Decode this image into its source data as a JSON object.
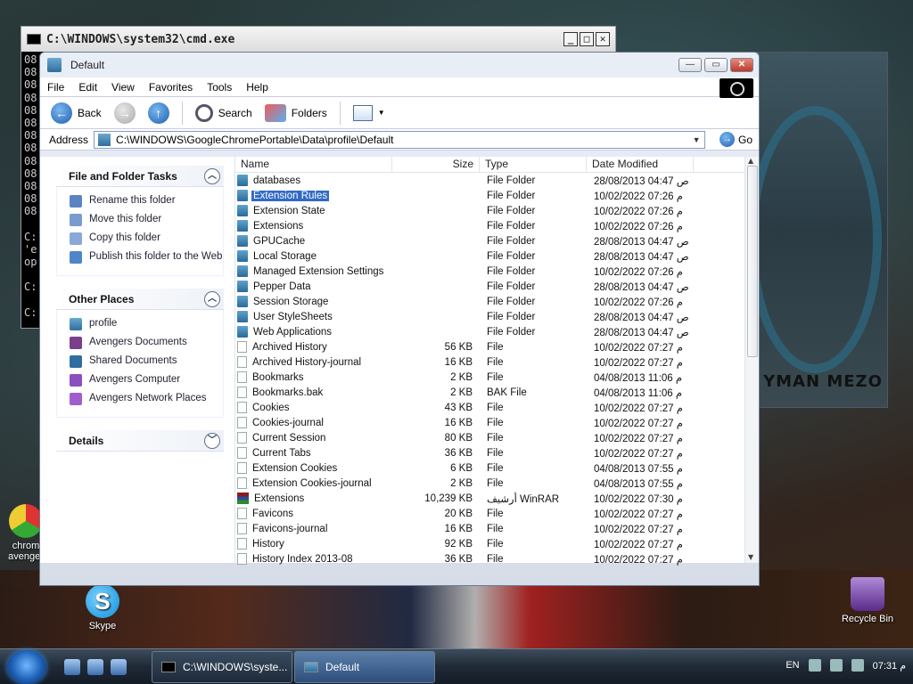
{
  "cmd": {
    "title": "C:\\WINDOWS\\system32\\cmd.exe",
    "lines": [
      "08",
      "08",
      "08",
      "08",
      "08",
      "08",
      "08",
      "08",
      "08",
      "08",
      "08",
      "08",
      "08",
      "",
      "C:",
      "'e",
      "op",
      "",
      "C:",
      "",
      "C:"
    ]
  },
  "window": {
    "title": "Default",
    "menu": [
      "File",
      "Edit",
      "View",
      "Favorites",
      "Tools",
      "Help"
    ],
    "toolbar": {
      "back": "Back",
      "search": "Search",
      "folders": "Folders"
    },
    "address": {
      "label": "Address",
      "value": "C:\\WINDOWS\\GoogleChromePortable\\Data\\profile\\Default",
      "go": "Go"
    }
  },
  "leftpane": {
    "tasks_title": "File and Folder Tasks",
    "tasks": [
      "Rename this folder",
      "Move this folder",
      "Copy this folder",
      "Publish this folder to the Web"
    ],
    "other_title": "Other Places",
    "places": [
      "profile",
      "Avengers Documents",
      "Shared Documents",
      "Avengers Computer",
      "Avengers Network Places"
    ],
    "details_title": "Details"
  },
  "columns": {
    "name": "Name",
    "size": "Size",
    "type": "Type",
    "date": "Date Modified"
  },
  "files": [
    {
      "name": "databases",
      "size": "",
      "type": "File Folder",
      "date": "28/08/2013 04:47 ص",
      "kind": "folder"
    },
    {
      "name": "Extension Rules",
      "size": "",
      "type": "File Folder",
      "date": "10/02/2022 07:26 م",
      "kind": "folder",
      "selected": true
    },
    {
      "name": "Extension State",
      "size": "",
      "type": "File Folder",
      "date": "10/02/2022 07:26 م",
      "kind": "folder"
    },
    {
      "name": "Extensions",
      "size": "",
      "type": "File Folder",
      "date": "10/02/2022 07:26 م",
      "kind": "folder"
    },
    {
      "name": "GPUCache",
      "size": "",
      "type": "File Folder",
      "date": "28/08/2013 04:47 ص",
      "kind": "folder"
    },
    {
      "name": "Local Storage",
      "size": "",
      "type": "File Folder",
      "date": "28/08/2013 04:47 ص",
      "kind": "folder"
    },
    {
      "name": "Managed Extension Settings",
      "size": "",
      "type": "File Folder",
      "date": "10/02/2022 07:26 م",
      "kind": "folder"
    },
    {
      "name": "Pepper Data",
      "size": "",
      "type": "File Folder",
      "date": "28/08/2013 04:47 ص",
      "kind": "folder"
    },
    {
      "name": "Session Storage",
      "size": "",
      "type": "File Folder",
      "date": "10/02/2022 07:26 م",
      "kind": "folder"
    },
    {
      "name": "User StyleSheets",
      "size": "",
      "type": "File Folder",
      "date": "28/08/2013 04:47 ص",
      "kind": "folder"
    },
    {
      "name": "Web Applications",
      "size": "",
      "type": "File Folder",
      "date": "28/08/2013 04:47 ص",
      "kind": "folder"
    },
    {
      "name": "Archived History",
      "size": "56 KB",
      "type": "File",
      "date": "10/02/2022 07:27 م",
      "kind": "file"
    },
    {
      "name": "Archived History-journal",
      "size": "16 KB",
      "type": "File",
      "date": "10/02/2022 07:27 م",
      "kind": "file"
    },
    {
      "name": "Bookmarks",
      "size": "2 KB",
      "type": "File",
      "date": "04/08/2013 11:06 م",
      "kind": "file"
    },
    {
      "name": "Bookmarks.bak",
      "size": "2 KB",
      "type": "BAK File",
      "date": "04/08/2013 11:06 م",
      "kind": "file"
    },
    {
      "name": "Cookies",
      "size": "43 KB",
      "type": "File",
      "date": "10/02/2022 07:27 م",
      "kind": "file"
    },
    {
      "name": "Cookies-journal",
      "size": "16 KB",
      "type": "File",
      "date": "10/02/2022 07:27 م",
      "kind": "file"
    },
    {
      "name": "Current Session",
      "size": "80 KB",
      "type": "File",
      "date": "10/02/2022 07:27 م",
      "kind": "file"
    },
    {
      "name": "Current Tabs",
      "size": "36 KB",
      "type": "File",
      "date": "10/02/2022 07:27 م",
      "kind": "file"
    },
    {
      "name": "Extension Cookies",
      "size": "6 KB",
      "type": "File",
      "date": "04/08/2013 07:55 م",
      "kind": "file"
    },
    {
      "name": "Extension Cookies-journal",
      "size": "2 KB",
      "type": "File",
      "date": "04/08/2013 07:55 م",
      "kind": "file"
    },
    {
      "name": "Extensions",
      "size": "10,239 KB",
      "type": "أرشيف WinRAR",
      "date": "10/02/2022 07:30 م",
      "kind": "rar"
    },
    {
      "name": "Favicons",
      "size": "20 KB",
      "type": "File",
      "date": "10/02/2022 07:27 م",
      "kind": "file"
    },
    {
      "name": "Favicons-journal",
      "size": "16 KB",
      "type": "File",
      "date": "10/02/2022 07:27 م",
      "kind": "file"
    },
    {
      "name": "History",
      "size": "92 KB",
      "type": "File",
      "date": "10/02/2022 07:27 م",
      "kind": "file"
    },
    {
      "name": "History Index 2013-08",
      "size": "36 KB",
      "type": "File",
      "date": "10/02/2022 07:27 م",
      "kind": "file"
    }
  ],
  "desktop": {
    "skype": "Skype",
    "recycle": "Recycle Bin",
    "chrome": "chrom avenger",
    "avengers_brand": "YMAN MEZO"
  },
  "taskbar": {
    "tasks": [
      "C:\\WINDOWS\\syste...",
      "Default"
    ],
    "lang": "EN",
    "clock": "07:31 م"
  }
}
